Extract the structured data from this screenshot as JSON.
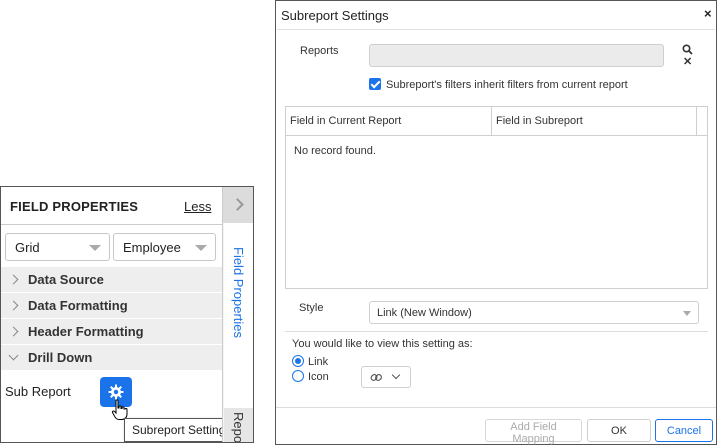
{
  "field_properties": {
    "title": "FIELD PROPERTIES",
    "less_link": "Less",
    "select_grid": "Grid",
    "select_field": "Employee",
    "sections": [
      {
        "label": "Data Source",
        "expanded": false
      },
      {
        "label": "Data Formatting",
        "expanded": false
      },
      {
        "label": "Header Formatting",
        "expanded": false
      },
      {
        "label": "Drill Down",
        "expanded": true
      }
    ],
    "sub_report_label": "Sub Report",
    "tooltip": "Subreport Settings",
    "vertical_tab": "Field Properties",
    "vertical_tab_2": "Repo"
  },
  "dialog": {
    "title": "Subreport Settings",
    "close": "×",
    "reports_label": "Reports",
    "reports_value": "",
    "inherit_checked": true,
    "inherit_label": "Subreport's filters inherit filters from current report",
    "grid": {
      "columns": [
        "Field in Current Report",
        "Field in Subreport"
      ],
      "empty_text": "No record found."
    },
    "style_label": "Style",
    "style_value": "Link (New Window)",
    "view_as_label": "You would like to view this setting as:",
    "options": [
      {
        "label": "Link",
        "selected": true
      },
      {
        "label": "Icon",
        "selected": false
      }
    ],
    "buttons": {
      "add_field_mapping": "Add Field Mapping",
      "ok": "OK",
      "cancel": "Cancel"
    }
  },
  "colors": {
    "accent": "#1a73e8",
    "section_bg": "#eeeeee"
  }
}
